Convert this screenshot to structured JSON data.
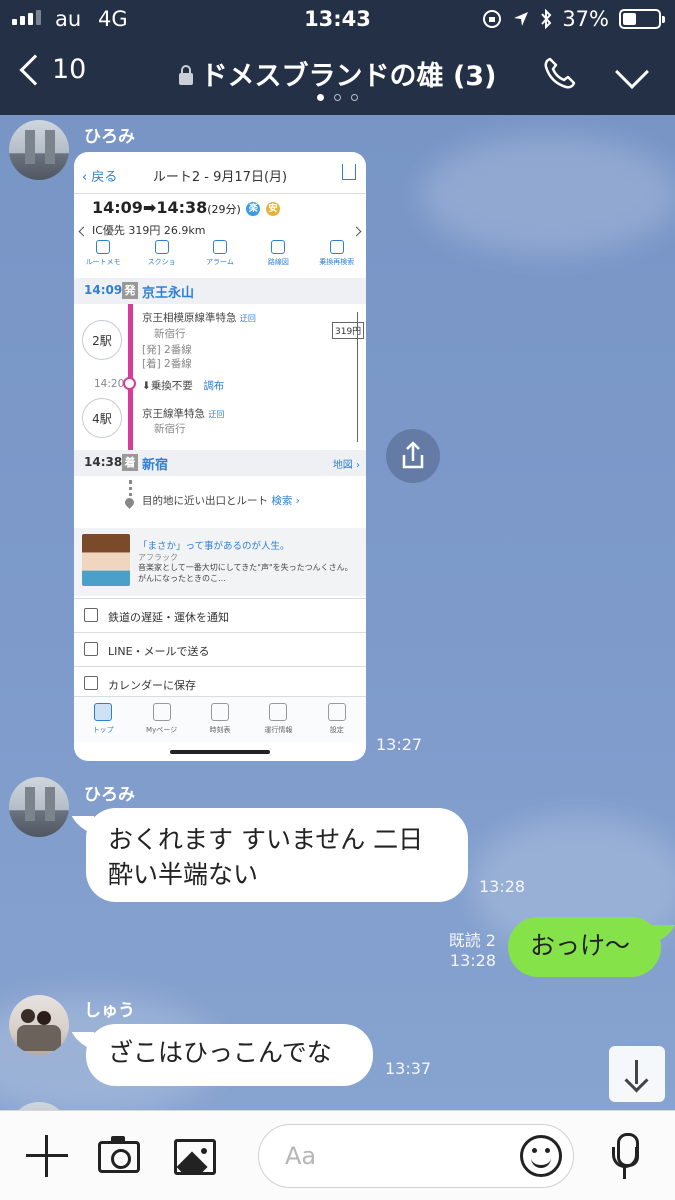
{
  "status_bar": {
    "carrier": "au",
    "network": "4G",
    "time": "13:43",
    "battery": "37%",
    "battery_level": 0.37
  },
  "header": {
    "back_count": "10",
    "title": "ドメスブランドの雄 (3)",
    "page_dots": 3,
    "active_dot": 0
  },
  "shared_image": {
    "back_label": "戻る",
    "title": "ルート2 - 9月17日(月)",
    "times": "14:09➡14:38",
    "duration": "(29分)",
    "badge_1": "楽",
    "badge_2": "安",
    "fare_line": "IC優先 319円 26.9km",
    "tools": [
      "ルートメモ",
      "スクショ",
      "アラーム",
      "路線図",
      "乗換再検索"
    ],
    "depart": {
      "time": "14:09",
      "mark": "発",
      "station": "京王永山"
    },
    "leg1": {
      "stops": "2駅",
      "line": "京王相模原線準特急",
      "detour": "迂回",
      "direction": "新宿行",
      "platform_dep_label": "[発]",
      "platform_dep": "2番線",
      "platform_arr_label": "[着]",
      "platform_arr": "2番線"
    },
    "transfer": {
      "time": "14:20",
      "note": "乗換不要",
      "station": "調布"
    },
    "leg2": {
      "stops": "4駅",
      "line": "京王線準特急",
      "detour": "迂回",
      "direction": "新宿行"
    },
    "fare_box": "319円",
    "arrive": {
      "time": "14:38",
      "mark": "着",
      "station": "新宿",
      "map": "地図"
    },
    "exit_route": "目的地に近い出口とルート",
    "exit_search": "検索",
    "ad_title": "「まさか」って事があるのが人生。",
    "ad_sponsor": "アフラック",
    "ad_text": "音楽家として一番大切にしてきた\"声\"を失ったつんくさん。がんになったときのこ…",
    "menu": [
      "鉄道の遅延・運休を通知",
      "LINE・メールで送る",
      "カレンダーに保存"
    ],
    "tabs": [
      "トップ",
      "Myページ",
      "時刻表",
      "運行情報",
      "設定"
    ]
  },
  "messages": [
    {
      "sender": "ひろみ",
      "type": "image",
      "time": "13:27"
    },
    {
      "sender": "ひろみ",
      "type": "text",
      "text_line1": "おくれます すいません 二日",
      "text_line2": "酔い半端ない",
      "time": "13:28"
    },
    {
      "sender": "me",
      "type": "text",
      "text": "おっけ〜",
      "read": "既読 2",
      "time": "13:28"
    },
    {
      "sender": "しゅう",
      "type": "text",
      "text": "ざこはひっこんでな",
      "time": "13:37"
    }
  ],
  "input": {
    "placeholder": "Aa"
  },
  "icons": [
    "back-chevron-icon",
    "lock-icon",
    "phone-icon",
    "chevron-down-icon",
    "share-icon",
    "scroll-down-icon",
    "plus-icon",
    "camera-icon",
    "image-icon",
    "emoji-icon",
    "mic-icon"
  ],
  "colors": {
    "header_bg": "#243046",
    "chat_bg": "#7a97c7",
    "my_bubble": "#85e249",
    "other_bubble": "#ffffff",
    "route_line": "#d63c98",
    "link_blue": "#2f7fd3"
  }
}
